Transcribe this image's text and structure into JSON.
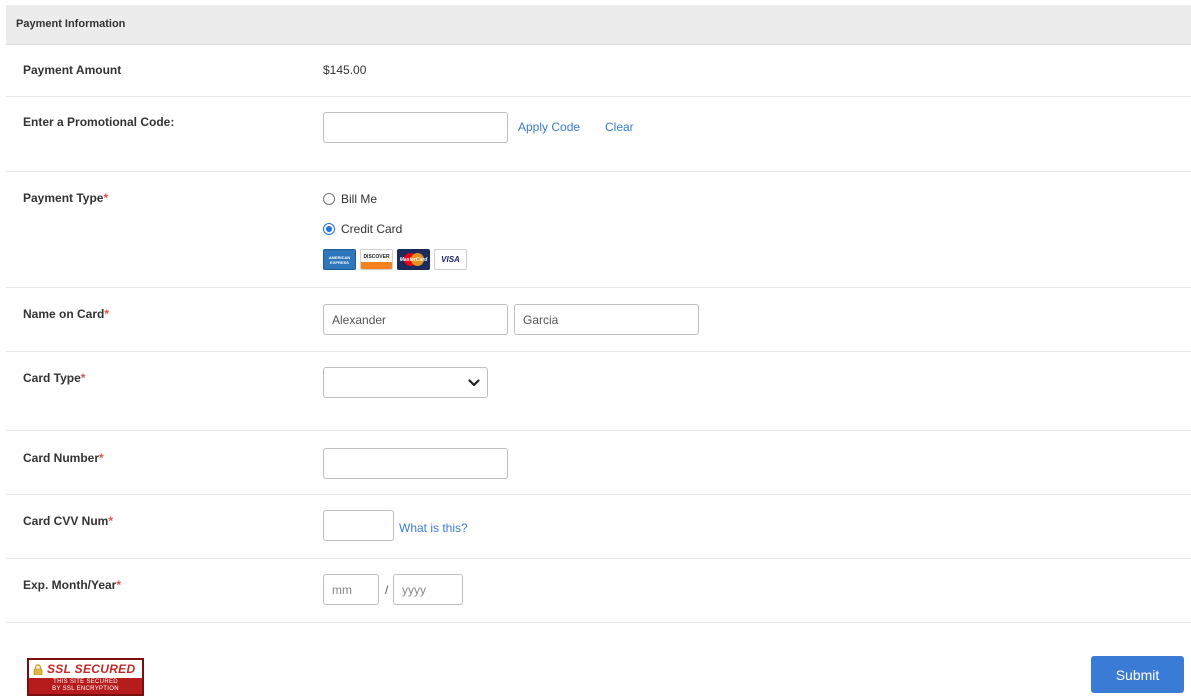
{
  "header": {
    "title": "Payment Information"
  },
  "payment_amount": {
    "label": "Payment Amount",
    "value": "$145.00"
  },
  "promo": {
    "label": "Enter a Promotional Code:",
    "value": "",
    "apply_label": "Apply Code",
    "clear_label": "Clear"
  },
  "payment_type": {
    "label": "Payment Type",
    "required_mark": "*",
    "options": [
      {
        "label": "Bill Me",
        "checked": false
      },
      {
        "label": "Credit Card",
        "checked": true
      }
    ],
    "card_logos": [
      "amex-logo",
      "discover-logo",
      "mastercard-logo",
      "visa-logo"
    ],
    "card_logo_text": {
      "amex": "AMERICAN EXPRESS",
      "discover": "DISCOVER",
      "mastercard": "MasterCard",
      "visa": "VISA"
    }
  },
  "name_on_card": {
    "label": "Name on Card",
    "required_mark": "*",
    "first": "Alexander",
    "last": "Garcia"
  },
  "card_type": {
    "label": "Card Type",
    "required_mark": "*",
    "selected": ""
  },
  "card_number": {
    "label": "Card Number",
    "required_mark": "*",
    "value": ""
  },
  "cvv": {
    "label": "Card CVV Num",
    "required_mark": "*",
    "value": "",
    "help_link": "What is this?"
  },
  "expiry": {
    "label": "Exp. Month/Year",
    "required_mark": "*",
    "month_placeholder": "mm",
    "separator": "/",
    "year_placeholder": "yyyy"
  },
  "ssl_badge": {
    "title": "SSL SECURED",
    "line1": "THIS SITE SECURED",
    "line2": "BY SSL ENCRYPTION"
  },
  "submit": {
    "label": "Submit"
  },
  "colors": {
    "accent": "#3a7bd5",
    "required": "#d9534f",
    "header_bg": "#ececec"
  }
}
